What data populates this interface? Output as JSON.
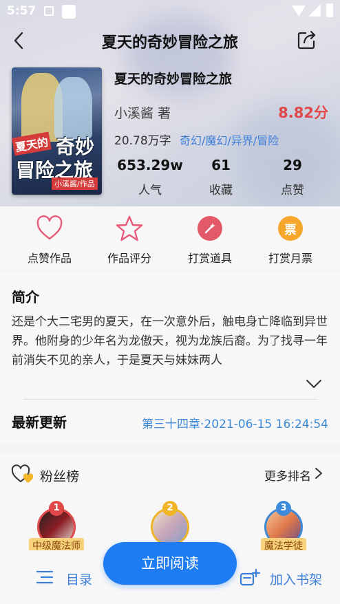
{
  "status_bar": {
    "time": "5:57"
  },
  "header": {
    "title": "夏天的奇妙冒险之旅"
  },
  "cover": {
    "title_part1": "夏天的",
    "title_part2": "奇妙",
    "title_part3": "冒险之旅",
    "author_tag": "小溪酱/作品"
  },
  "book": {
    "name": "夏天的奇妙冒险之旅",
    "author": "小溪酱   著",
    "score": "8.82分",
    "word_count": "20.78万字",
    "tags": "奇幻/魔幻/异界/冒险",
    "stats": [
      {
        "value": "653.29w",
        "label": "人气"
      },
      {
        "value": "61",
        "label": "收藏"
      },
      {
        "value": "29",
        "label": "点赞"
      }
    ]
  },
  "actions": [
    {
      "label": "点赞作品",
      "icon": "heart-icon"
    },
    {
      "label": "作品评分",
      "icon": "star-icon"
    },
    {
      "label": "打赏道具",
      "icon": "wand-icon"
    },
    {
      "label": "打赏月票",
      "icon": "ticket-icon",
      "glyph": "票"
    }
  ],
  "intro": {
    "heading": "简介",
    "text": "还是个大二宅男的夏天，在一次意外后，触电身亡降临到异世界。他附身的少年名为龙傲天，视为龙族后裔。为了找寻一年前消失不见的亲人，于是夏天与妹妹两人",
    "latest_label": "最新更新",
    "latest_value": "第三十四章·2021-06-15 16:24:54"
  },
  "fans": {
    "title": "粉丝榜",
    "more": "更多排名",
    "items": [
      {
        "rank": "1",
        "badge": "中级魔法师",
        "color": "#e0484a"
      },
      {
        "rank": "2",
        "badge": "",
        "color": "#f0b429"
      },
      {
        "rank": "3",
        "badge": "魔法学徒",
        "color": "#3d8ad8"
      }
    ]
  },
  "bottom": {
    "menu": "目录",
    "read": "立即阅读",
    "shelf": "加入书架"
  },
  "colors": {
    "accent": "#1e7cf2",
    "score": "#e0484a",
    "link": "#3d7ed8"
  }
}
